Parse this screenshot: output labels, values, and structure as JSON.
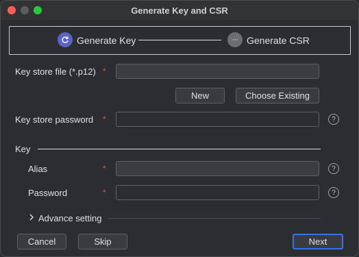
{
  "window": {
    "title": "Generate Key and CSR"
  },
  "steps": [
    {
      "label": "Generate Key",
      "icon": "refresh-icon",
      "state": "active"
    },
    {
      "label": "Generate CSR",
      "icon": "ellipsis-icon",
      "state": "pending"
    }
  ],
  "keystore": {
    "file_label": "Key store file (*.p12)",
    "file_value": "",
    "new_label": "New",
    "choose_label": "Choose Existing",
    "password_label": "Key store password",
    "password_value": ""
  },
  "key": {
    "section_label": "Key",
    "alias_label": "Alias",
    "alias_value": "",
    "password_label": "Password",
    "password_value": "",
    "advance_label": "Advance setting"
  },
  "required_marker": "*",
  "help_glyph": "?",
  "footer": {
    "cancel_label": "Cancel",
    "skip_label": "Skip",
    "next_label": "Next"
  },
  "colors": {
    "accent": "#3574f0",
    "step_active": "#5b63c9",
    "required": "#e0595b",
    "background": "#2b2d30"
  }
}
